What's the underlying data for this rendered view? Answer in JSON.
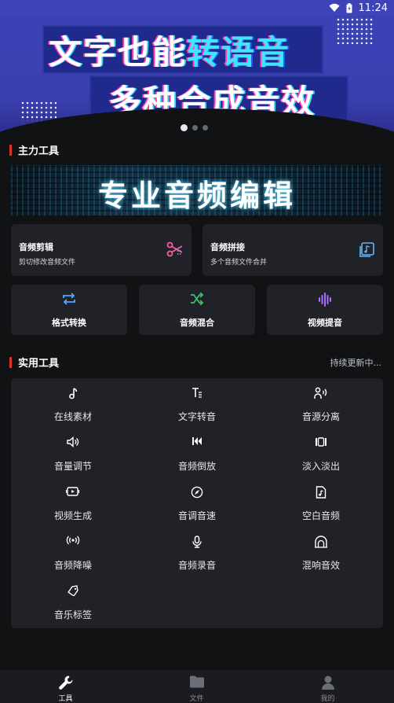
{
  "status": {
    "time": "11:24"
  },
  "banner": {
    "line1_plain": "文字也能",
    "line1_accent": "转语音",
    "line2": "多种合成音效",
    "pager_count": 3,
    "pager_active": 0
  },
  "main_tools": {
    "title": "主力工具",
    "pro_banner": "专业音频编辑",
    "cards": [
      {
        "title": "音频剪辑",
        "subtitle": "剪切修改音频文件",
        "icon": "scissors-icon",
        "color": "#ff5aa0"
      },
      {
        "title": "音频拼接",
        "subtitle": "多个音频文件合并",
        "icon": "music-files-icon",
        "color": "#5fb8ff"
      }
    ],
    "small_cards": [
      {
        "label": "格式转换",
        "icon": "repeat-icon",
        "color": "#4aa8ff"
      },
      {
        "label": "音频混合",
        "icon": "shuffle-icon",
        "color": "#36c26b"
      },
      {
        "label": "视频提音",
        "icon": "waveform-icon",
        "color": "#a373ff"
      }
    ]
  },
  "practical_tools": {
    "title": "实用工具",
    "note": "持续更新中...",
    "items": [
      {
        "label": "在线素材",
        "icon": "music-note-icon"
      },
      {
        "label": "文字转音",
        "icon": "text-icon"
      },
      {
        "label": "音源分离",
        "icon": "voice-separate-icon"
      },
      {
        "label": "音量调节",
        "icon": "volume-icon"
      },
      {
        "label": "音频倒放",
        "icon": "rewind-icon"
      },
      {
        "label": "淡入淡出",
        "icon": "fade-icon"
      },
      {
        "label": "视频生成",
        "icon": "video-icon"
      },
      {
        "label": "音调音速",
        "icon": "compass-icon"
      },
      {
        "label": "空白音频",
        "icon": "blank-audio-icon"
      },
      {
        "label": "音频降噪",
        "icon": "noise-reduce-icon"
      },
      {
        "label": "音频录音",
        "icon": "microphone-icon"
      },
      {
        "label": "混响音效",
        "icon": "reverb-icon"
      },
      {
        "label": "音乐标签",
        "icon": "tag-icon"
      }
    ]
  },
  "nav": {
    "items": [
      {
        "label": "工具",
        "icon": "wrench-icon",
        "active": true
      },
      {
        "label": "文件",
        "icon": "folder-icon",
        "active": false
      },
      {
        "label": "我的",
        "icon": "user-icon",
        "active": false
      }
    ]
  }
}
